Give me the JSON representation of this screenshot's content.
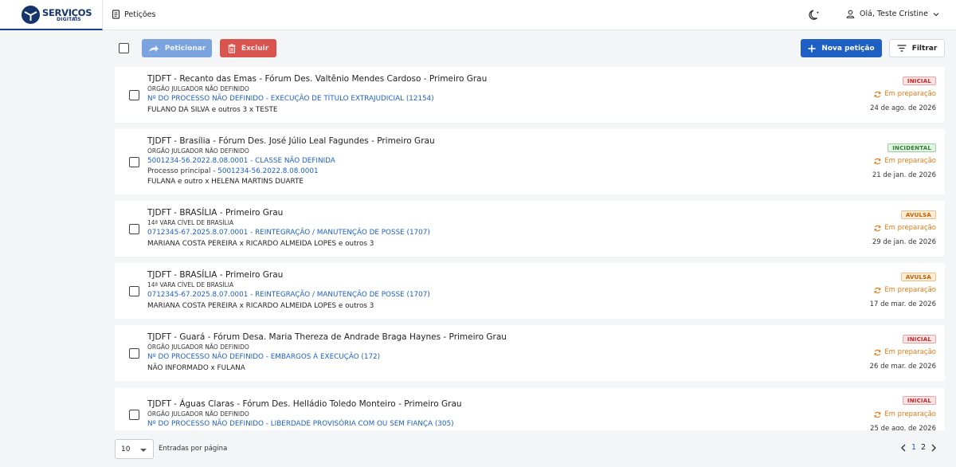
{
  "header": {
    "logo_line1": "SERVIÇOS",
    "logo_line2": "DIGITAIS",
    "nav_label": "Petições",
    "user_greeting": "Olá, Teste Cristine"
  },
  "toolbar": {
    "peticionar_label": "Peticionar",
    "excluir_label": "Excluir",
    "nova_label": "Nova petição",
    "filtrar_label": "Filtrar"
  },
  "petitions": [
    {
      "title": "TJDFT - Recanto das Emas - Fórum Des. Valtênio Mendes Cardoso - Primeiro Grau",
      "orgao": "ÓRGÃO JULGADOR NÃO DEFINIDO",
      "processo": "Nº DO PROCESSO NÃO DEFINIDO - EXECUÇÃO DE TÍTULO EXTRAJUDICIAL (12154)",
      "partes": "FULANO DA SILVA e outros 3 x TESTE",
      "tipo": "INICIAL",
      "status": "Em preparação",
      "data": "24 de ago. de 2026"
    },
    {
      "title": "TJDFT - Brasília - Fórum Des. José Júlio Leal Fagundes - Primeiro Grau",
      "orgao": "ÓRGÃO JULGADOR NÃO DEFINIDO",
      "processo": "5001234-56.2022.8.08.0001 - CLASSE NÃO DEFINIDA",
      "principal_label": "Processo principal - ",
      "principal_numero": "5001234-56.2022.8.08.0001",
      "partes": "FULANA e outro x HELENA MARTINS DUARTE",
      "tipo": "INCIDENTAL",
      "status": "Em preparação",
      "data": "21 de jan. de 2026"
    },
    {
      "title": "TJDFT - BRASÍLIA - Primeiro Grau",
      "orgao": "14ª VARA CÍVEL DE BRASÍLIA",
      "processo": "0712345-67.2025.8.07.0001 - REINTEGRAÇÃO / MANUTENÇÃO DE POSSE (1707)",
      "partes": "MARIANA COSTA PEREIRA x RICARDO ALMEIDA LOPES e outros 3",
      "tipo": "AVULSA",
      "status": "Em preparação",
      "data": "29 de jan. de 2026"
    },
    {
      "title": "TJDFT - BRASÍLIA - Primeiro Grau",
      "orgao": "14ª VARA CÍVEL DE BRASÍLIA",
      "processo": "0712345-67.2025.8.07.0001 - REINTEGRAÇÃO / MANUTENÇÃO DE POSSE (1707)",
      "partes": "MARIANA COSTA PEREIRA x RICARDO ALMEIDA LOPES e outros 3",
      "tipo": "AVULSA",
      "status": "Em preparação",
      "data": "17 de mar. de 2026"
    },
    {
      "title": "TJDFT - Guará - Fórum Desa. Maria Thereza de Andrade Braga Haynes - Primeiro Grau",
      "orgao": "ÓRGÃO JULGADOR NÃO DEFINIDO",
      "processo": "Nº DO PROCESSO NÃO DEFINIDO - EMBARGOS À EXECUÇÃO (172)",
      "partes": "NÃO INFORMADO x FULANA",
      "tipo": "INICIAL",
      "status": "Em preparação",
      "data": "26 de mar. de 2026"
    },
    {
      "title": "TJDFT - Águas Claras - Fórum Des. Helládio Toledo Monteiro - Primeiro Grau",
      "orgao": "ÓRGÃO JULGADOR NÃO DEFINIDO",
      "processo": "Nº DO PROCESSO NÃO DEFINIDO - LIBERDADE PROVISÓRIA COM OU SEM FIANÇA (305)",
      "partes": "",
      "tipo": "INICIAL",
      "status": "Em preparação",
      "data": "25 de ago. de 2026"
    }
  ],
  "footer": {
    "per_page_value": "10",
    "per_page_label": "Entradas por página",
    "page1": "1",
    "page2": "2"
  },
  "colors": {
    "primary": "#1d5fc2",
    "danger": "#d9534f",
    "status_orange": "#e07a12"
  }
}
